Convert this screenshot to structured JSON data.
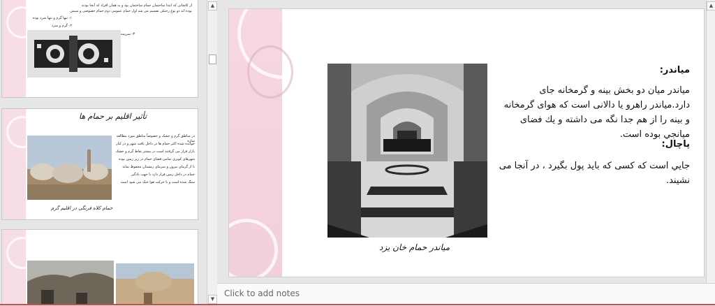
{
  "thumbnails": {
    "slide1": {
      "lines": [
        "از کاشانی که ابتدا ساختمان حمام ساختمان بود و به همان افراد که آنجا بودند",
        "بوده اند دو نوع رختکن تقسیم می شد اول حمام عمومی دوم حمام خصوصی و سپس",
        "۱- تنها گرم و تنها سرد بوده",
        "۲- گرم و سرد",
        "۳- سربینه گرم و سرد می باشد که شود"
      ]
    },
    "slide2": {
      "title": "تأثیر اقلیم بر حمام ها",
      "lines": [
        "در مناطق گرم و خشک و خصوصاً مناطق مورد مطالعه سازه",
        "خوانده شده اکثر حمام ها در داخل بافت شهر و در کنار",
        "بازار قرار می گرفتند است در بیشتر نقاط گرم و خشک",
        "شهرهای کویری تمامی فضای حمام در زیر زمین بوده",
        "تا از گرمای بیرون و سرمای زمستان محفوظ بماند",
        "حمام در داخل زمین قرار دارد با جهت بادگیر",
        "سنگ شده است و با حرکت هوا خنک می شود است"
      ],
      "caption": "حمام کلاه فرنگی در اقلیم گرم"
    }
  },
  "slide": {
    "heading1": "میاندر:",
    "paragraph1": "میاندر میان دو بخش بینه و گرمخانه جای دارد.میاندر راهرو یا دالانی است که هوای گرمخانه و بینه را از هم جدا نگه می داشته و یك فضای میانجي بوده است.",
    "heading2": "پاچال:",
    "paragraph2": "جایي است که کسی که باید پول بگیرد ، در آنجا می نشیند.",
    "photo_caption": "میاندر حمام خان یزد"
  },
  "notes": {
    "placeholder": "Click to add notes"
  },
  "colors": {
    "slide_accent_pink": "#f6d7e2",
    "status_accent": "#c0504d"
  }
}
